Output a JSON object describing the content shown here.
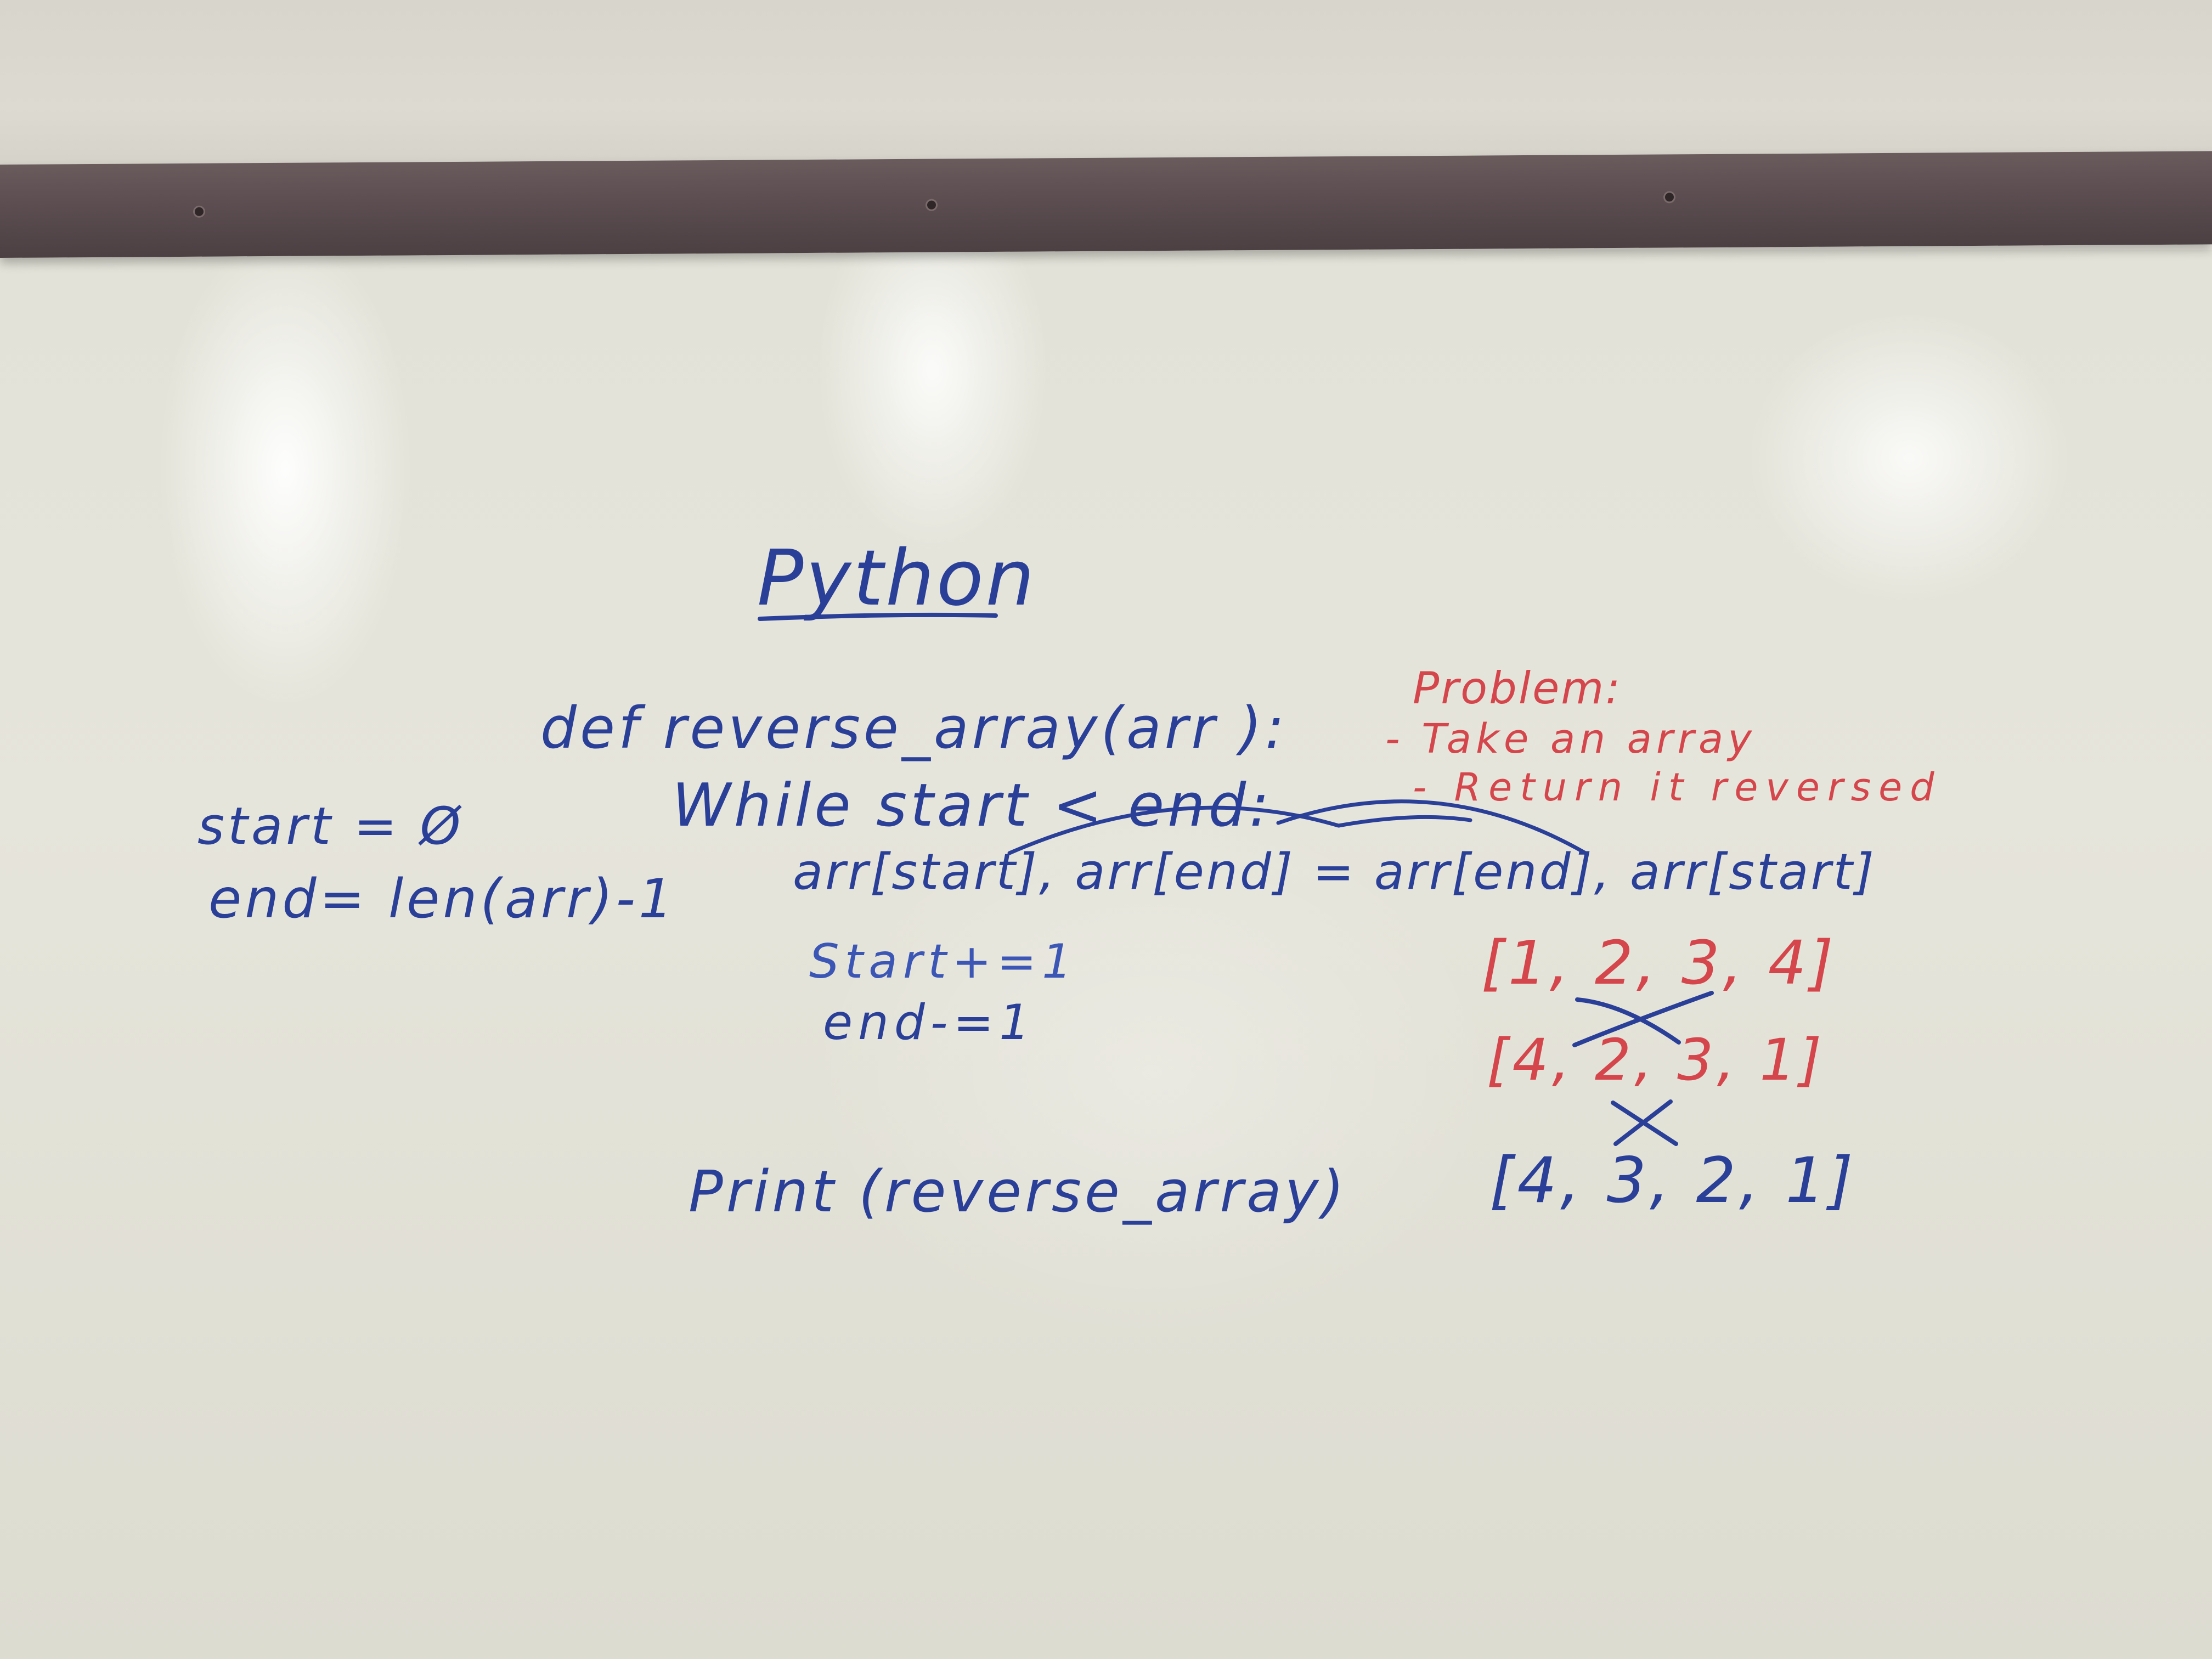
{
  "whiteboard": {
    "title": "Python",
    "code": {
      "def_line": "def reverse_array(arr ):",
      "while_line": "While start < end:",
      "swap_line": "arr[start], arr[end] = arr[end], arr[start]",
      "increment_line": "Start+=1",
      "decrement_line": "end-=1",
      "print_line": "Print (reverse_array)"
    },
    "vars": {
      "start_line": "start = Ø",
      "end_line": "end= len(arr)-1"
    },
    "problem": {
      "heading": "Problem:",
      "line1": "- Take an array",
      "line2": "- Return it reversed"
    },
    "example": {
      "row1": "[1, 2, 3, 4]",
      "row2": "[4, 2, 3, 1]",
      "row3": "[4, 3, 2, 1]"
    }
  },
  "colors": {
    "blue_marker": "#2a3f98",
    "red_marker": "#d4464c",
    "rail": "#5b4d50"
  }
}
